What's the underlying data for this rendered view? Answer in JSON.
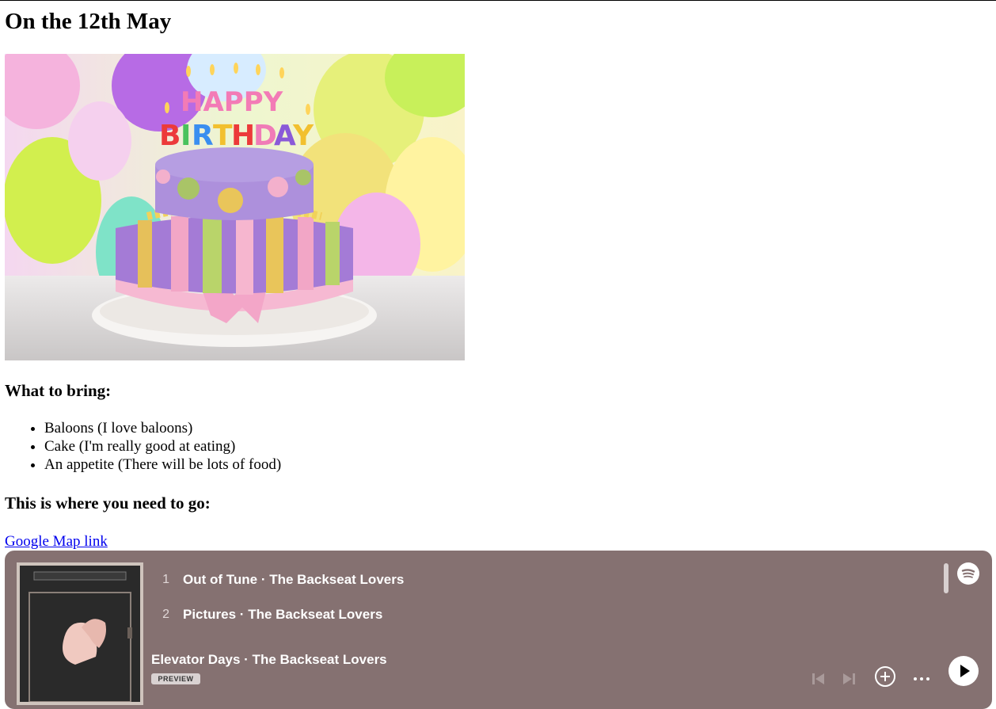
{
  "page": {
    "title": "On the 12th May",
    "cake_image": {
      "icon": "birthday-cake-photo",
      "caption_text": "HAPPY BIRTHDAY"
    },
    "bring_heading": "What to bring:",
    "bring_items": [
      "Baloons (I love baloons)",
      "Cake (I'm really good at eating)",
      "An appetite (There will be lots of food)"
    ],
    "go_heading": "This is where you need to go:",
    "map_link": "Google Map link"
  },
  "spotify": {
    "background": "#857171",
    "tracks": [
      {
        "num": "1",
        "title": "Out of Tune · The Backseat Lovers"
      },
      {
        "num": "2",
        "title": "Pictures · The Backseat Lovers"
      }
    ],
    "now_playing": "Elevator Days · The Backseat Lovers",
    "preview_label": "PREVIEW",
    "icons": [
      "spotify-logo-icon",
      "previous-icon",
      "next-icon",
      "add-icon",
      "more-icon",
      "play-icon"
    ]
  }
}
